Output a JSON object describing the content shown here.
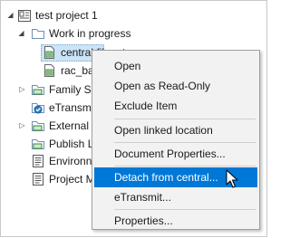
{
  "tree": {
    "items": [
      {
        "label": "test project 1",
        "icon": "project-icon"
      },
      {
        "label": "Work in progress",
        "icon": "folder-open-icon"
      },
      {
        "label": "central file.rvt",
        "icon": "revit-file-icon"
      },
      {
        "label": "rac_ba",
        "icon": "revit-file-icon"
      },
      {
        "label": "Family Se",
        "icon": "sync-folder-icon"
      },
      {
        "label": "eTransm",
        "icon": "sync-folder-icon"
      },
      {
        "label": "External ",
        "icon": "sync-folder-icon"
      },
      {
        "label": "Publish L",
        "icon": "sync-folder-icon"
      },
      {
        "label": "Environn",
        "icon": "document-icon"
      },
      {
        "label": "Project M",
        "icon": "document-icon"
      }
    ]
  },
  "context_menu": {
    "items": [
      "Open",
      "Open as Read-Only",
      "Exclude Item",
      "Open linked location",
      "Document Properties...",
      "Detach from central...",
      "eTransmit...",
      "Properties..."
    ],
    "highlighted": "Detach from central..."
  },
  "colors": {
    "highlight": "#0078d7",
    "selection": "#cce4f7",
    "menu_bg": "#f2f2f2"
  }
}
